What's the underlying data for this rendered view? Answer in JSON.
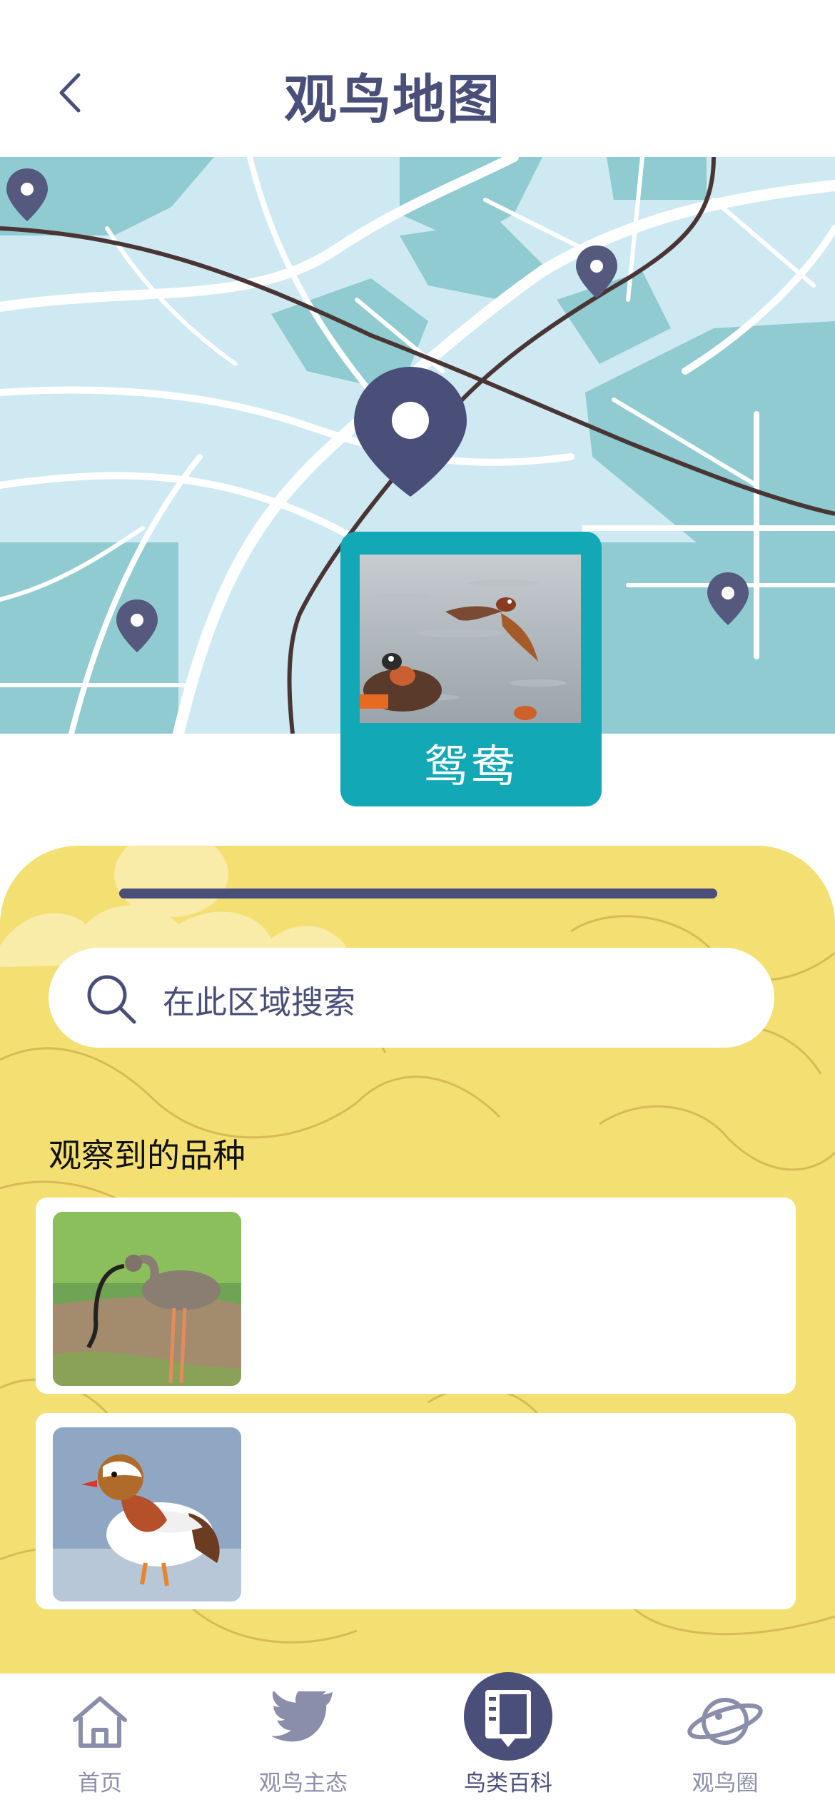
{
  "header": {
    "title": "观鸟地图"
  },
  "map": {
    "popup_bird_name": "鸳鸯"
  },
  "sheet": {
    "search_placeholder": "在此区域搜索",
    "section_title": "观察到的品种"
  },
  "tabbar": {
    "items": [
      {
        "label": "首页",
        "icon": "home-icon"
      },
      {
        "label": "观鸟主态",
        "icon": "bird-icon"
      },
      {
        "label": "鸟类百科",
        "icon": "book-icon",
        "active": true
      },
      {
        "label": "观鸟圈",
        "icon": "planet-icon"
      }
    ]
  },
  "colors": {
    "primary": "#4a4f7a",
    "accent_teal": "#12a8b6",
    "sheet_yellow": "#f4df73",
    "map_water": "#cfe9f3",
    "map_block": "#8fcbd0"
  }
}
